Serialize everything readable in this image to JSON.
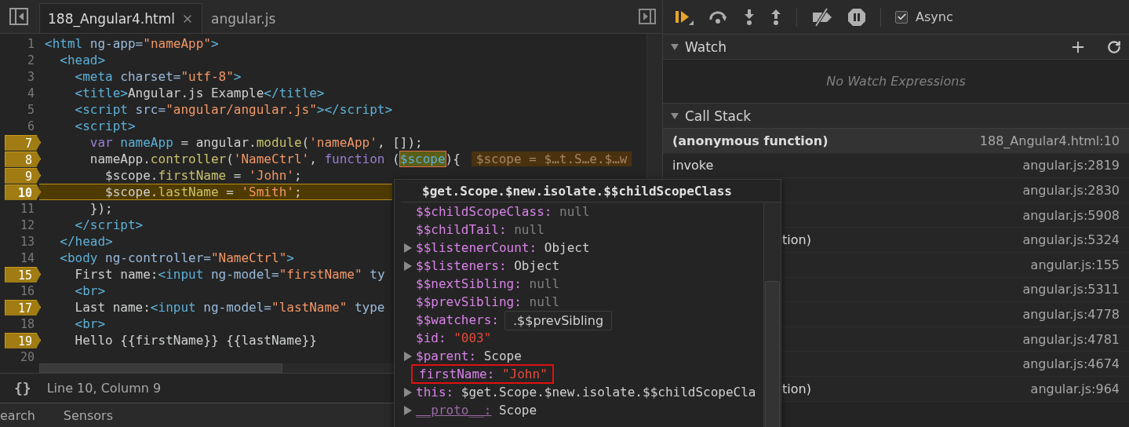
{
  "editor": {
    "tabs": [
      {
        "label": "188_Angular4.html",
        "selected": true,
        "closable": true
      },
      {
        "label": "angular.js",
        "selected": false,
        "closable": false
      }
    ],
    "lines": [
      {
        "number": "1",
        "breakpoint": false,
        "current": false,
        "tokens": [
          {
            "t": "<html",
            "kind": "tag"
          },
          {
            "t": " ng-app",
            "kind": "attr"
          },
          {
            "t": "=",
            "kind": "attr"
          },
          {
            "t": "\"nameApp\"",
            "kind": "str"
          },
          {
            "t": ">",
            "kind": "tag"
          }
        ]
      },
      {
        "number": "2",
        "breakpoint": false,
        "current": false,
        "tokens": [
          {
            "t": "  <head>",
            "kind": "tag"
          }
        ]
      },
      {
        "number": "3",
        "breakpoint": false,
        "current": false,
        "tokens": [
          {
            "t": "    <meta",
            "kind": "tag"
          },
          {
            "t": " charset",
            "kind": "attr"
          },
          {
            "t": "=",
            "kind": "attr"
          },
          {
            "t": "\"utf-8\"",
            "kind": "str"
          },
          {
            "t": ">",
            "kind": "tag"
          }
        ]
      },
      {
        "number": "4",
        "breakpoint": false,
        "current": false,
        "tokens": [
          {
            "t": "    <title>",
            "kind": "tag"
          },
          {
            "t": "Angular.js Example",
            "kind": "text"
          },
          {
            "t": "</title>",
            "kind": "tag"
          }
        ]
      },
      {
        "number": "5",
        "breakpoint": false,
        "current": false,
        "tokens": [
          {
            "t": "    <script",
            "kind": "tag"
          },
          {
            "t": " src",
            "kind": "attr"
          },
          {
            "t": "=",
            "kind": "attr"
          },
          {
            "t": "\"angular/angular.js\"",
            "kind": "str"
          },
          {
            "t": "></script>",
            "kind": "tag"
          }
        ]
      },
      {
        "number": "6",
        "breakpoint": false,
        "current": false,
        "tokens": [
          {
            "t": "    <script>",
            "kind": "tag"
          }
        ]
      },
      {
        "number": "7",
        "breakpoint": true,
        "current": false,
        "tokens": [
          {
            "t": "      var",
            "kind": "kw"
          },
          {
            "t": " nameApp",
            "kind": "var"
          },
          {
            "t": " = angular.",
            "kind": "text"
          },
          {
            "t": "module",
            "kind": "fn"
          },
          {
            "t": "(",
            "kind": "text"
          },
          {
            "t": "'nameApp'",
            "kind": "str"
          },
          {
            "t": ", []);",
            "kind": "text"
          }
        ]
      },
      {
        "number": "8",
        "breakpoint": true,
        "current": false,
        "tokens": [
          {
            "t": "      nameApp.",
            "kind": "text"
          },
          {
            "t": "controller",
            "kind": "fn"
          },
          {
            "t": "(",
            "kind": "text"
          },
          {
            "t": "'NameCtrl'",
            "kind": "str"
          },
          {
            "t": ", ",
            "kind": "text"
          },
          {
            "t": "function",
            "kind": "kw"
          },
          {
            "t": " (",
            "kind": "text"
          },
          {
            "t": "$scope",
            "kind": "hover"
          },
          {
            "t": "){",
            "kind": "text"
          },
          {
            "t": "$scope = $…t.S…e.$…w",
            "kind": "inline"
          }
        ]
      },
      {
        "number": "9",
        "breakpoint": true,
        "current": false,
        "tokens": [
          {
            "t": "        $scope.",
            "kind": "text"
          },
          {
            "t": "firstName",
            "kind": "fn"
          },
          {
            "t": " = ",
            "kind": "text"
          },
          {
            "t": "'John'",
            "kind": "str"
          },
          {
            "t": ";",
            "kind": "text"
          }
        ]
      },
      {
        "number": "10",
        "breakpoint": true,
        "current": true,
        "tokens": [
          {
            "t": "        $scope.",
            "kind": "text"
          },
          {
            "t": "lastName",
            "kind": "fn"
          },
          {
            "t": " = ",
            "kind": "text"
          },
          {
            "t": "'Smith'",
            "kind": "str"
          },
          {
            "t": ";",
            "kind": "text"
          }
        ]
      },
      {
        "number": "11",
        "breakpoint": false,
        "current": false,
        "tokens": [
          {
            "t": "      });",
            "kind": "text"
          }
        ]
      },
      {
        "number": "12",
        "breakpoint": false,
        "current": false,
        "tokens": [
          {
            "t": "    </script>",
            "kind": "tag"
          }
        ]
      },
      {
        "number": "13",
        "breakpoint": false,
        "current": false,
        "tokens": [
          {
            "t": "  </head>",
            "kind": "tag"
          }
        ]
      },
      {
        "number": "14",
        "breakpoint": false,
        "current": false,
        "tokens": [
          {
            "t": "  <body",
            "kind": "tag"
          },
          {
            "t": " ng-controller",
            "kind": "attr"
          },
          {
            "t": "=",
            "kind": "attr"
          },
          {
            "t": "\"NameCtrl\"",
            "kind": "str"
          },
          {
            "t": ">",
            "kind": "tag"
          }
        ]
      },
      {
        "number": "15",
        "breakpoint": true,
        "current": false,
        "tokens": [
          {
            "t": "    First name:",
            "kind": "text"
          },
          {
            "t": "<input",
            "kind": "tag"
          },
          {
            "t": " ng-model",
            "kind": "attr"
          },
          {
            "t": "=",
            "kind": "attr"
          },
          {
            "t": "\"firstName\"",
            "kind": "str"
          },
          {
            "t": " ty",
            "kind": "attr"
          }
        ]
      },
      {
        "number": "16",
        "breakpoint": false,
        "current": false,
        "tokens": [
          {
            "t": "    <br>",
            "kind": "tag"
          }
        ]
      },
      {
        "number": "17",
        "breakpoint": true,
        "current": false,
        "tokens": [
          {
            "t": "    Last name:",
            "kind": "text"
          },
          {
            "t": "<input",
            "kind": "tag"
          },
          {
            "t": " ng-model",
            "kind": "attr"
          },
          {
            "t": "=",
            "kind": "attr"
          },
          {
            "t": "\"lastName\"",
            "kind": "str"
          },
          {
            "t": " type",
            "kind": "attr"
          }
        ]
      },
      {
        "number": "18",
        "breakpoint": false,
        "current": false,
        "tokens": [
          {
            "t": "    <br>",
            "kind": "tag"
          }
        ]
      },
      {
        "number": "19",
        "breakpoint": true,
        "current": false,
        "tokens": [
          {
            "t": "    Hello {{firstName}} {{lastName}}",
            "kind": "text"
          }
        ]
      },
      {
        "number": "20",
        "breakpoint": false,
        "current": false
      }
    ],
    "status": {
      "format_button": "{}",
      "position": "Line 10, Column 9"
    }
  },
  "drawer_tabs": [
    "earch",
    "Sensors"
  ],
  "popover": {
    "title": "$get.Scope.$new.isolate.$$childScopeClass",
    "items": [
      {
        "name": "$$childScopeClass:",
        "value": "null",
        "kind": "null",
        "expandable": false,
        "outlined": false
      },
      {
        "name": "$$childTail:",
        "value": "null",
        "kind": "null",
        "expandable": false,
        "outlined": false
      },
      {
        "name": "$$listenerCount:",
        "value": "Object",
        "kind": "object",
        "expandable": true,
        "outlined": false
      },
      {
        "name": "$$listeners:",
        "value": "Object",
        "kind": "object",
        "expandable": true,
        "outlined": false
      },
      {
        "name": "$$nextSibling:",
        "value": "null",
        "kind": "null",
        "expandable": false,
        "outlined": false
      },
      {
        "name": "$$prevSibling:",
        "value": "null",
        "kind": "null",
        "expandable": false,
        "outlined": false
      },
      {
        "name": "$$watchers:",
        "expandable": false,
        "outlined": false
      },
      {
        "name": "$id:",
        "value": "\"003\"",
        "kind": "string",
        "expandable": false,
        "outlined": false
      },
      {
        "name": "$parent:",
        "value": "Scope",
        "kind": "object",
        "expandable": true,
        "outlined": false
      },
      {
        "name": "firstName:",
        "value": "\"John\"",
        "kind": "string",
        "expandable": false,
        "outlined": true
      },
      {
        "name": "this:",
        "value": "$get.Scope.$new.isolate.$$childScopeCla",
        "kind": "object",
        "expandable": true,
        "outlined": false
      },
      {
        "name": "__proto__:",
        "value": "Scope",
        "kind": "object",
        "expandable": true,
        "outlined": false,
        "internal": true
      }
    ],
    "tooltip": ".$$prevSibling"
  },
  "debugger": {
    "async": {
      "label": "Async",
      "checked": true
    },
    "watch": {
      "title": "Watch",
      "expanded": true,
      "empty_text": "No Watch Expressions"
    },
    "call_stack": {
      "title": "Call Stack",
      "expanded": true,
      "frames": [
        {
          "kind": "full",
          "name": "(anonymous function)",
          "location": "188_Angular4.html:10",
          "selected": true
        },
        {
          "kind": "full",
          "name": "invoke",
          "location": "angular.js:2819",
          "selected": false
        },
        {
          "kind": "hidden",
          "location": "angular.js:2830",
          "selected": false
        },
        {
          "kind": "hidden",
          "location": "angular.js:5908",
          "selected": false
        },
        {
          "kind": "partial",
          "name": "tion)",
          "location": "angular.js:5324",
          "selected": false
        },
        {
          "kind": "hidden",
          "location": "angular.js:155",
          "selected": false
        },
        {
          "kind": "hidden",
          "location": "angular.js:5311",
          "selected": false
        },
        {
          "kind": "hidden",
          "location": "angular.js:4778",
          "selected": false
        },
        {
          "kind": "hidden",
          "location": "angular.js:4781",
          "selected": false
        },
        {
          "kind": "hidden",
          "location": "angular.js:4674",
          "selected": false
        },
        {
          "kind": "partial",
          "name": "tion)",
          "location": "angular.js:964",
          "selected": false
        }
      ]
    }
  }
}
